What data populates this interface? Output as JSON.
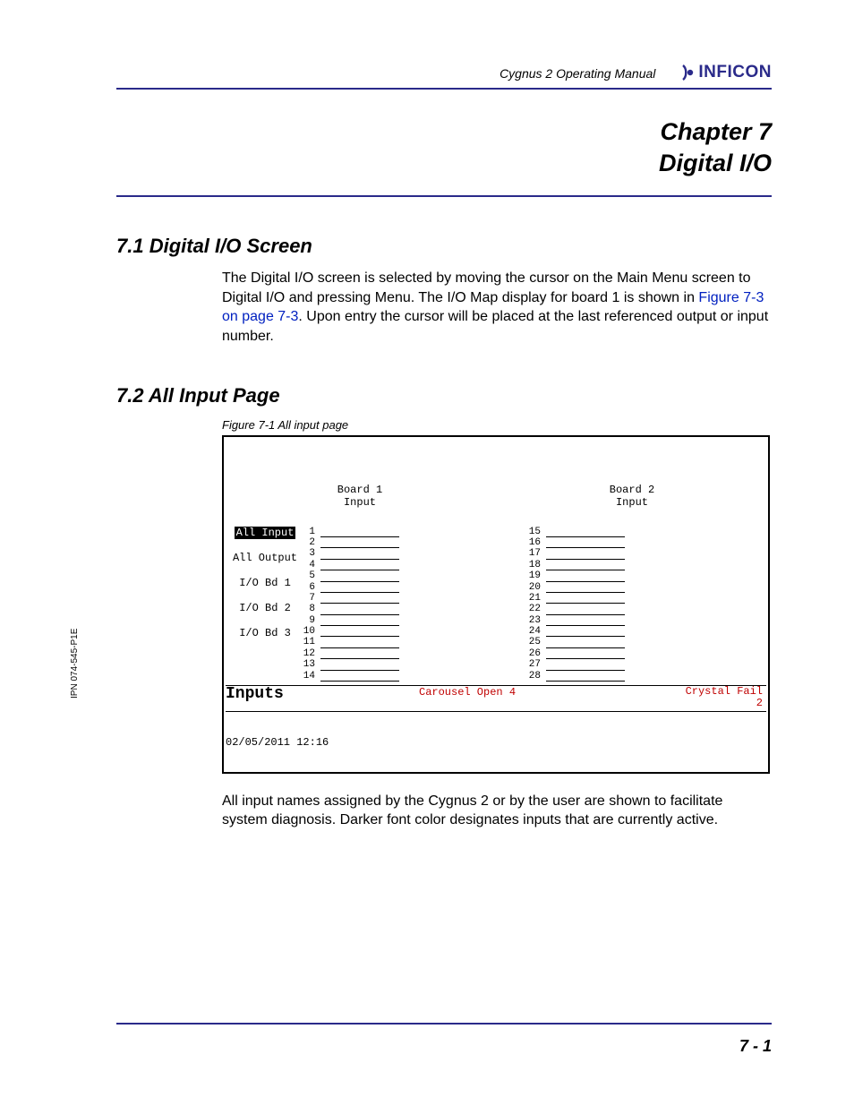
{
  "header": {
    "manual_title": "Cygnus 2 Operating Manual",
    "brand": "INFICON"
  },
  "chapter": {
    "line1": "Chapter 7",
    "line2": "Digital I/O"
  },
  "section71": {
    "heading": "7.1  Digital I/O Screen",
    "para_a": "The Digital I/O screen is selected by moving the cursor on the Main Menu screen to Digital I/O and pressing Menu. The I/O Map display for board 1 is shown in ",
    "xref": "Figure 7-3 on page 7-3",
    "para_b": ". Upon entry the cursor will be placed at the last referenced output or input number."
  },
  "section72": {
    "heading": "7.2  All Input Page",
    "fig_caption": "Figure 7-1  All input page",
    "board1_label": "Board 1",
    "board2_label": "Board 2",
    "input_label": "Input",
    "nav_items": [
      "All Input",
      "All Output",
      "I/O Bd 1",
      "I/O Bd 2",
      "I/O Bd 3"
    ],
    "col1_numbers": [
      "1",
      "2",
      "3",
      "4",
      "5",
      "6",
      "7",
      "8",
      "9",
      "10",
      "11",
      "12",
      "13",
      "14"
    ],
    "col2_numbers": [
      "15",
      "16",
      "17",
      "18",
      "19",
      "20",
      "21",
      "22",
      "23",
      "24",
      "25",
      "26",
      "27",
      "28"
    ],
    "status_left": "Inputs",
    "status_mid": "Carousel Open 4",
    "status_right_l1": "Crystal Fail",
    "status_right_l2": "2",
    "timestamp": "02/05/2011  12:16",
    "body_after": "All input names assigned by the Cygnus 2 or by the user are shown to facilitate system diagnosis. Darker font color designates inputs that are currently active."
  },
  "side_ipn": "IPN 074-545-P1E",
  "page_number": "7 - 1"
}
